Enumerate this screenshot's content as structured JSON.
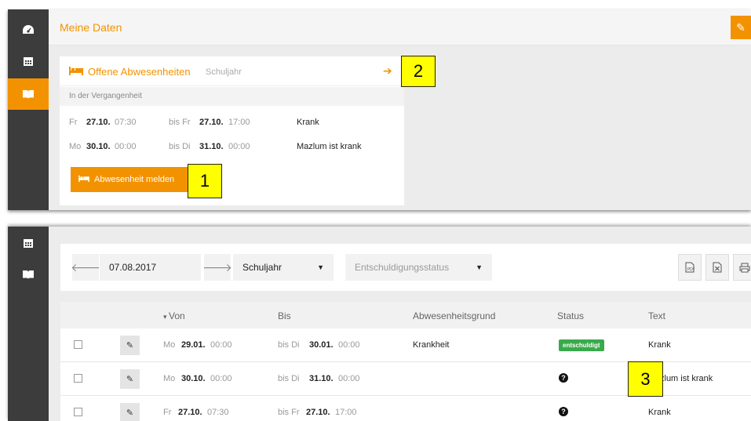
{
  "top": {
    "header_title": "Meine Daten",
    "card": {
      "title": "Offene Abwesenheiten",
      "subtitle": "Schuljahr",
      "past_label": "In der Vergangenheit",
      "rows": [
        {
          "from_day": "Fr",
          "from_date": "27.10.",
          "from_time": "07:30",
          "to_day": "bis Fr",
          "to_date": "27.10.",
          "to_time": "17:00",
          "text": "Krank"
        },
        {
          "from_day": "Mo",
          "from_date": "30.10.",
          "from_time": "00:00",
          "to_day": "bis Di",
          "to_date": "31.10.",
          "to_time": "00:00",
          "text": "Mazlum ist krank"
        }
      ],
      "report_button": "Abwesenheit melden"
    }
  },
  "callouts": {
    "c1": "1",
    "c2": "2",
    "c3": "3"
  },
  "bottom": {
    "toolbar": {
      "date": "07.08.2017",
      "period": "Schuljahr",
      "status_placeholder": "Entschuldigungsstatus"
    },
    "table": {
      "headers": {
        "von": "Von",
        "bis": "Bis",
        "grund": "Abwesenheitsgrund",
        "status": "Status",
        "text": "Text"
      },
      "rows": [
        {
          "from_day": "Mo",
          "from_date": "29.01.",
          "from_time": "00:00",
          "to_day": "bis Di",
          "to_date": "30.01.",
          "to_time": "00:00",
          "grund": "Krankheit",
          "status": "entschuldigt",
          "text": "Krank"
        },
        {
          "from_day": "Mo",
          "from_date": "30.10.",
          "from_time": "00:00",
          "to_day": "bis Di",
          "to_date": "31.10.",
          "to_time": "00:00",
          "grund": "",
          "status": "?",
          "text": "zlum ist krank"
        },
        {
          "from_day": "Fr",
          "from_date": "27.10.",
          "from_time": "07:30",
          "to_day": "bis Fr",
          "to_date": "27.10.",
          "to_time": "17:00",
          "grund": "",
          "status": "?",
          "text": "Krank"
        }
      ]
    }
  },
  "colors": {
    "accent": "#f39200",
    "sidebar": "#3c3c3c",
    "badge_green": "#3aa94b",
    "callout": "#ffff00"
  },
  "icons": [
    "dashboard-icon",
    "calendar-icon",
    "book-icon",
    "pencil-icon",
    "bed-icon",
    "arrow-right-icon",
    "arrow-left-icon",
    "pdf-icon",
    "excel-icon",
    "print-icon",
    "question-icon"
  ]
}
